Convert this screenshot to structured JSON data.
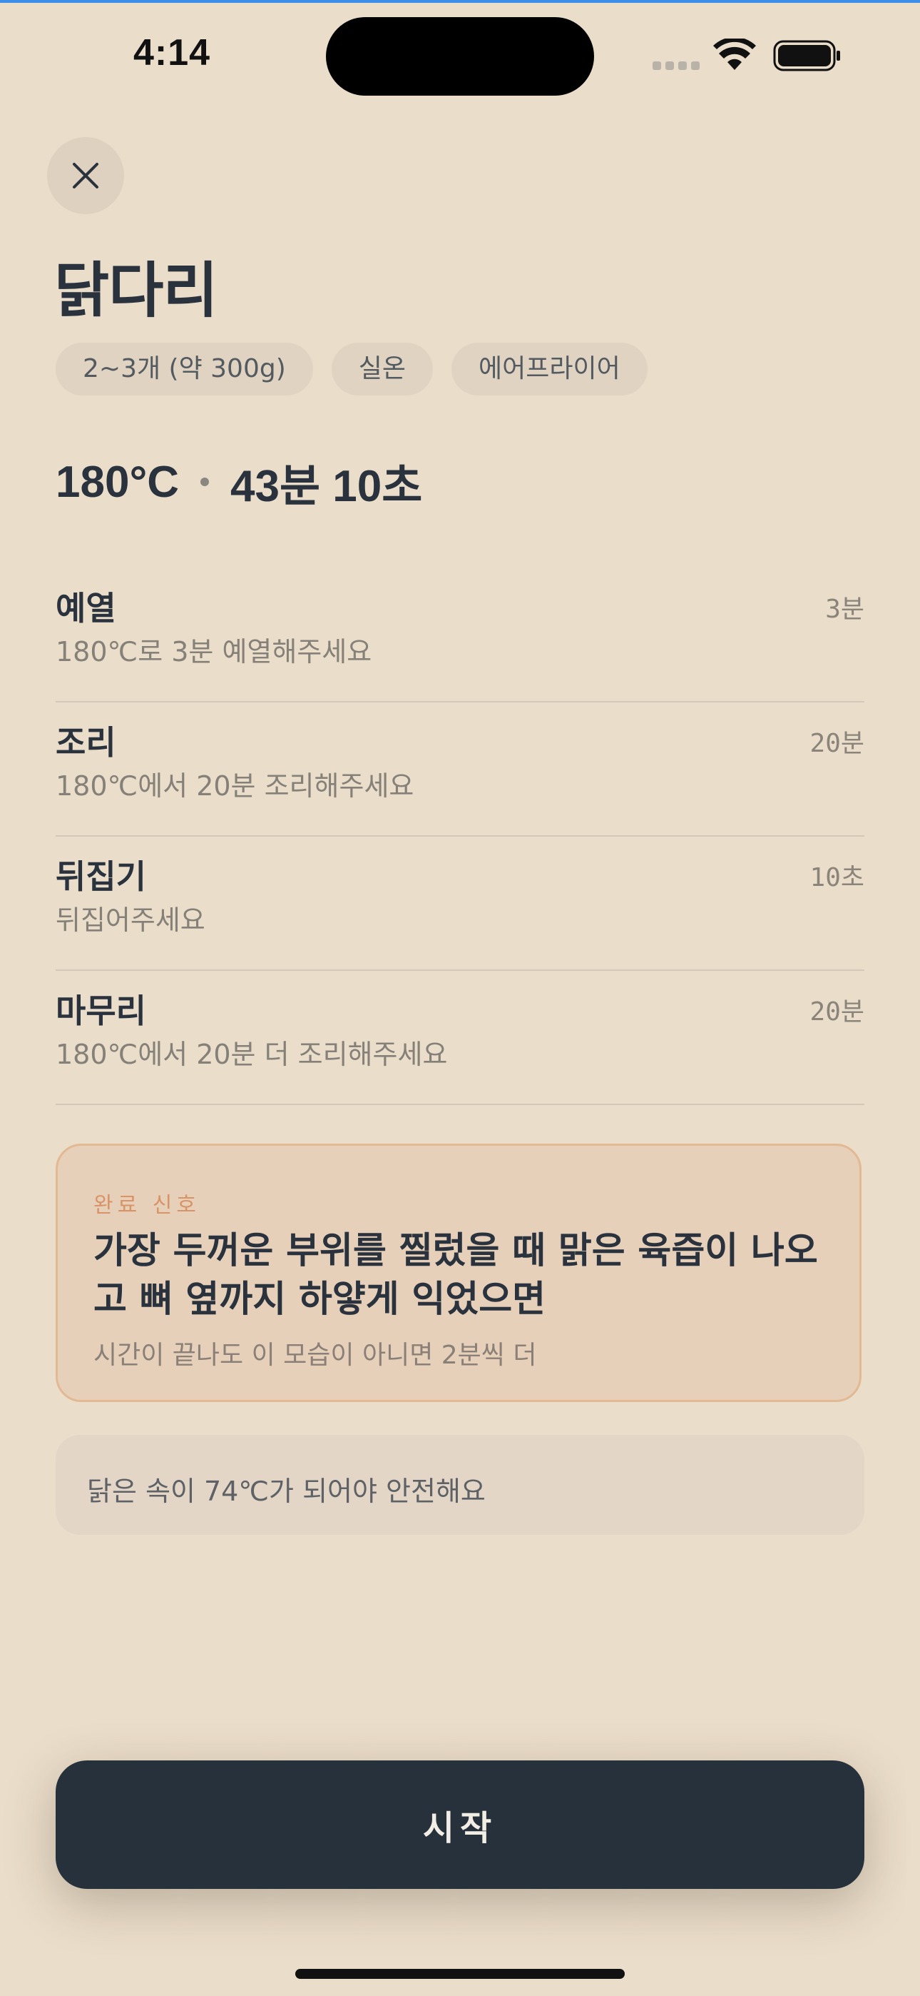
{
  "status_bar": {
    "time": "4:14",
    "icons": [
      "cellular-signal-icon",
      "wifi-icon",
      "battery-icon"
    ]
  },
  "header": {
    "close_icon": "close-icon",
    "title": "닭다리"
  },
  "chips": [
    {
      "label": "2~3개 (약 300g)"
    },
    {
      "label": "실온"
    },
    {
      "label": "에어프라이어"
    }
  ],
  "summary": {
    "temperature": "180°C",
    "total_time": "43분 10초"
  },
  "steps": [
    {
      "name": "예열",
      "description": "180℃로 3분 예열해주세요",
      "duration": "3분"
    },
    {
      "name": "조리",
      "description": "180℃에서 20분 조리해주세요",
      "duration": "20분"
    },
    {
      "name": "뒤집기",
      "description": "뒤집어주세요",
      "duration": "10초"
    },
    {
      "name": "마무리",
      "description": "180℃에서 20분 더 조리해주세요",
      "duration": "20분"
    }
  ],
  "completion_signal": {
    "label": "완료 신호",
    "text": "가장 두꺼운 부위를 찔렀을 때 맑은 육즙이 나오고 뼈 옆까지 하얗게 익었으면",
    "subtext": "시간이 끝나도 이 모습이 아니면 2분씩 더"
  },
  "note": {
    "text": "닭은 속이 74℃가 되어야 안전해요"
  },
  "primary_button": {
    "label": "시작"
  },
  "colors": {
    "background": "#EADDCA",
    "primary_dark": "#27313B",
    "accent_orange": "#D89467",
    "signal_card_bg": "#E6D0B9"
  }
}
